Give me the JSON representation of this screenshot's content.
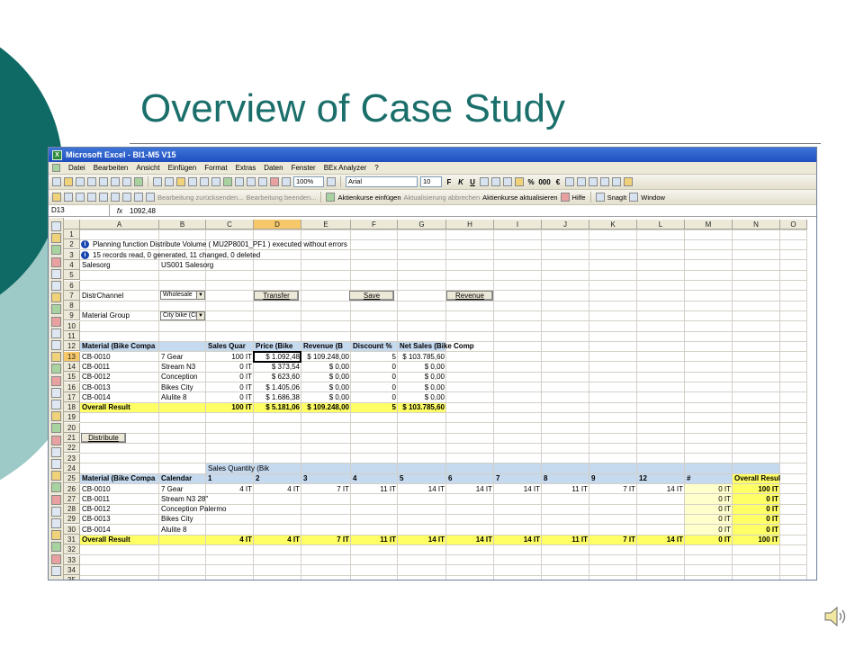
{
  "slide": {
    "title": "Overview of Case Study",
    "accent": "#1b6f6b",
    "accent_light": "#7fb7b3"
  },
  "window": {
    "title": "Microsoft Excel - BI1-M5 V15"
  },
  "menu": [
    "Datei",
    "Bearbeiten",
    "Ansicht",
    "Einfügen",
    "Format",
    "Extras",
    "Daten",
    "Fenster",
    "BEx Analyzer",
    "?"
  ],
  "toolbar": {
    "zoom": "100%",
    "font": "Arial",
    "size": "10",
    "bold": "F",
    "italic": "K",
    "underline": "U",
    "percent": "%",
    "thousands": "000",
    "euro": "€"
  },
  "toolbar2": {
    "review1": "Bearbeitung zurücksenden...",
    "review2": "Bearbeitung beenden...",
    "aktienkurse_einfuegen": "Aktienkurse einfügen",
    "aktualisierung_abbrechen": "Aktualisierung abbrechen",
    "aktienkurse_aktualisieren": "Aktienkurse aktualisieren",
    "hilfe": "Hilfe",
    "snagit": "SnagIt",
    "window": "Window"
  },
  "formula_bar": {
    "name_box": "D13",
    "fx": "fx",
    "value": "1092,48"
  },
  "columns": [
    "A",
    "B",
    "C",
    "D",
    "E",
    "F",
    "G",
    "H",
    "I",
    "J",
    "K",
    "L",
    "M",
    "N",
    "O"
  ],
  "rows": [
    "1",
    "2",
    "3",
    "4",
    "5",
    "6",
    "7",
    "8",
    "9",
    "10",
    "11",
    "12",
    "13",
    "14",
    "15",
    "16",
    "17",
    "18",
    "19",
    "20",
    "21",
    "22",
    "23",
    "24",
    "25",
    "26",
    "27",
    "28",
    "29",
    "30",
    "31",
    "32",
    "33",
    "34",
    "35"
  ],
  "messages": {
    "m1": "Planning function Distribute Volume ( MU2P8001_PF1 ) executed without errors",
    "m2": "15 records read, 0 generated, 11 changed, 0 deleted"
  },
  "filters": {
    "salesorg_label": "Salesorg",
    "salesorg_value": "US001 Salesorg",
    "distr_label": "DistrChannel",
    "distr_value": "Wholesale",
    "matgroup_label": "Material Group",
    "matgroup_value": "City bike (CE"
  },
  "buttons": {
    "transfer": "Transfer",
    "save": "Save",
    "revenue": "Revenue",
    "distribute": "Distribute"
  },
  "table1": {
    "headers": [
      "Material (Bike Compa",
      "",
      "Sales Quar",
      "Price (Bike",
      "Revenue (B",
      "Discount  %",
      "Net Sales (Bike Comp"
    ],
    "rows": [
      [
        "CB-0010",
        "7 Gear",
        "100 IT",
        "$ 1.092,48",
        "$ 109.248,00",
        "5",
        "$ 103.785,60"
      ],
      [
        "CB-0011",
        "Stream N3",
        "0 IT",
        "$ 373,54",
        "$ 0,00",
        "0",
        "$ 0,00"
      ],
      [
        "CB-0012",
        "Conception",
        "0 IT",
        "$ 623,60",
        "$ 0,00",
        "0",
        "$ 0,00"
      ],
      [
        "CB-0013",
        "Bikes City",
        "0 IT",
        "$ 1.405,06",
        "$ 0,00",
        "0",
        "$ 0,00"
      ],
      [
        "CB-0014",
        "Alulite 8",
        "0 IT",
        "$ 1.686,38",
        "$ 0,00",
        "0",
        "$ 0,00"
      ]
    ],
    "total": [
      "Overall Result",
      "",
      "100 IT",
      "$ 5.181,06",
      "$ 109.248,00",
      "5",
      "$ 103.785,60"
    ]
  },
  "table2": {
    "title": "Sales Quantity  (Bik",
    "headers": [
      "Material (Bike Compa",
      "Calendar",
      "1",
      "2",
      "3",
      "4",
      "5",
      "6",
      "7",
      "8",
      "9",
      "12",
      "#",
      "Overall Result"
    ],
    "rows": [
      [
        "CB-0010",
        "7 Gear",
        "4 IT",
        "4 IT",
        "7 IT",
        "11 IT",
        "14 IT",
        "14 IT",
        "14 IT",
        "11 IT",
        "7 IT",
        "14 IT",
        "0 IT",
        "100 IT"
      ],
      [
        "CB-0011",
        "Stream N3 28\"",
        "",
        "",
        "",
        "",
        "",
        "",
        "",
        "",
        "",
        "",
        "0 IT",
        "0 IT"
      ],
      [
        "CB-0012",
        "Conception Palermo",
        "",
        "",
        "",
        "",
        "",
        "",
        "",
        "",
        "",
        "",
        "0 IT",
        "0 IT"
      ],
      [
        "CB-0013",
        "Bikes City",
        "",
        "",
        "",
        "",
        "",
        "",
        "",
        "",
        "",
        "",
        "0 IT",
        "0 IT"
      ],
      [
        "CB-0014",
        "Alulite 8",
        "",
        "",
        "",
        "",
        "",
        "",
        "",
        "",
        "",
        "",
        "0 IT",
        "0 IT"
      ]
    ],
    "total": [
      "Overall Result",
      "",
      "4 IT",
      "4 IT",
      "7 IT",
      "11 IT",
      "14 IT",
      "14 IT",
      "14 IT",
      "11 IT",
      "7 IT",
      "14 IT",
      "0 IT",
      "100 IT"
    ]
  },
  "colors": {
    "excel_title": "#2a5ccc",
    "header_blue": "#c5d9ef",
    "result_yellow": "#ffff66",
    "data_yellow": "#ffffcc",
    "selected_orange": "#ffc000"
  }
}
